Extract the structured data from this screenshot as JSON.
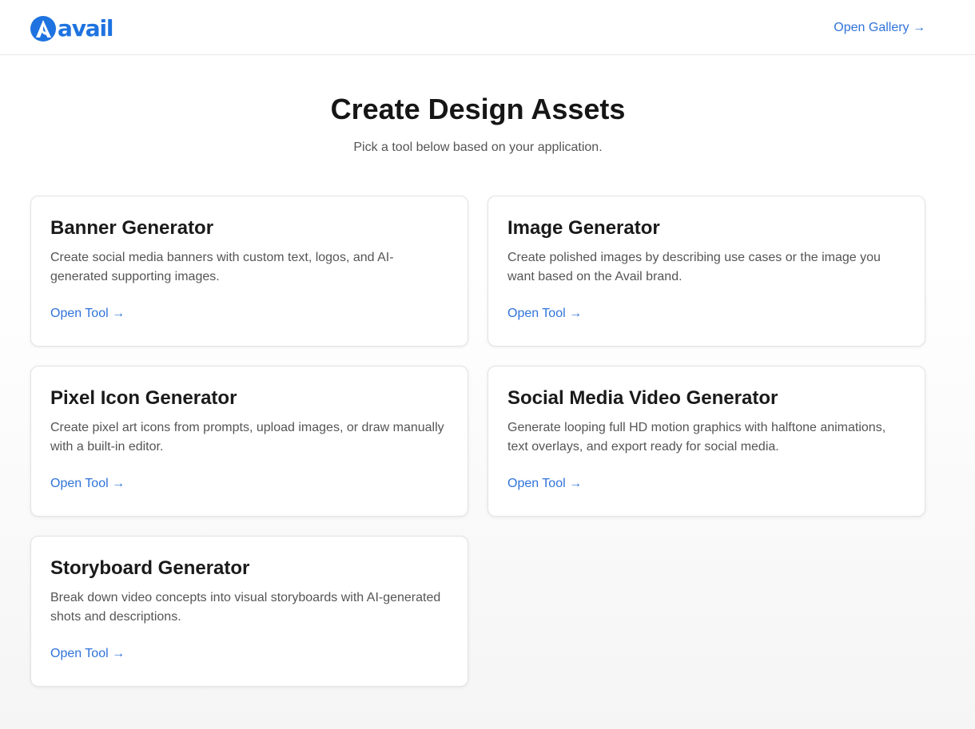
{
  "header": {
    "logo_text": "avail",
    "gallery_link": "Open Gallery →"
  },
  "hero": {
    "title": "Create Design Assets",
    "subtitle": "Pick a tool below based on your application."
  },
  "cards": [
    {
      "title": "Banner Generator",
      "description": "Create social media banners with custom text, logos, and AI-generated supporting images.",
      "link": "Open Tool →"
    },
    {
      "title": "Image Generator",
      "description": "Create polished images by describing use cases or the image you want based on the Avail brand.",
      "link": "Open Tool →"
    },
    {
      "title": "Pixel Icon Generator",
      "description": "Create pixel art icons from prompts, upload images, or draw manually with a built-in editor.",
      "link": "Open Tool →"
    },
    {
      "title": "Social Media Video Generator",
      "description": "Generate looping full HD motion graphics with halftone animations, text overlays, and export ready for social media.",
      "link": "Open Tool →"
    },
    {
      "title": "Storyboard Generator",
      "description": "Break down video concepts into visual storyboards with AI-generated shots and descriptions.",
      "link": "Open Tool →"
    }
  ],
  "colors": {
    "brand": "#1e73e0",
    "link": "#2f73d9",
    "text": "#1a1a1a",
    "muted": "#555555"
  }
}
